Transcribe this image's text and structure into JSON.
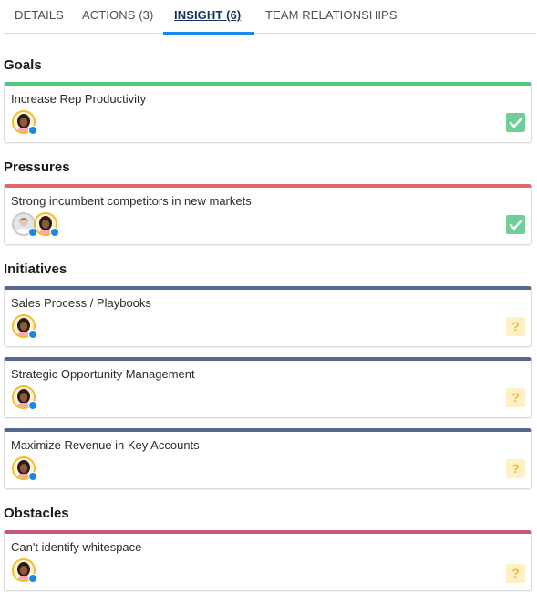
{
  "tabs": [
    {
      "label": "DETAILS",
      "active": false
    },
    {
      "label": "ACTIONS (3)",
      "active": false
    },
    {
      "label": "INSIGHT (6)",
      "active": true
    },
    {
      "label": "TEAM RELATIONSHIPS",
      "active": false
    }
  ],
  "sections": {
    "goals": {
      "heading": "Goals",
      "color": "#4bca81",
      "cards": [
        {
          "title": "Increase Rep Productivity",
          "avatars": [
            "woman-avatar"
          ],
          "status": "check"
        }
      ]
    },
    "pressures": {
      "heading": "Pressures",
      "color": "#e06868",
      "cards": [
        {
          "title": "Strong incumbent competitors in new markets",
          "avatars": [
            "man-avatar",
            "woman-avatar"
          ],
          "status": "check"
        }
      ]
    },
    "initiatives": {
      "heading": "Initiatives",
      "color": "#54698d",
      "cards": [
        {
          "title": "Sales Process / Playbooks",
          "avatars": [
            "woman-avatar"
          ],
          "status": "question"
        },
        {
          "title": "Strategic Opportunity Management",
          "avatars": [
            "woman-avatar"
          ],
          "status": "question"
        },
        {
          "title": "Maximize Revenue in Key Accounts",
          "avatars": [
            "woman-avatar"
          ],
          "status": "question"
        }
      ]
    },
    "obstacles": {
      "heading": "Obstacles",
      "color": "#c2577f",
      "cards": [
        {
          "title": "Can't identify whitespace",
          "avatars": [
            "woman-avatar"
          ],
          "status": "question"
        }
      ]
    }
  },
  "status_glyphs": {
    "question": "?"
  }
}
